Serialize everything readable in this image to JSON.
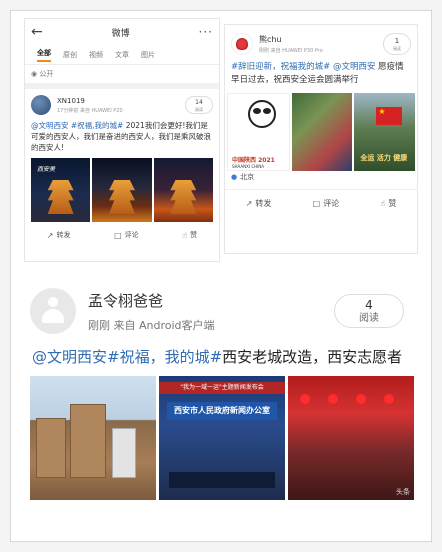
{
  "panel1": {
    "back_icon": "back-arrow-icon",
    "title": "微博",
    "more": "···",
    "tabs": [
      "全部",
      "原创",
      "视频",
      "文章",
      "图片"
    ],
    "public_label": "公开",
    "user": {
      "name": "XN1019",
      "meta": "17分钟前 来自 HUAWEI P20"
    },
    "read_count": "14",
    "read_label": "阅读",
    "text_prefix": "@文明西安 #祝福,我的城#",
    "text_body": " 2021我们会更好!我们是可爱的西安人，我们是奋进的西安人，我们是乘风破浪的西安人!",
    "photo_caption": "西安美",
    "actions": {
      "forward": "转发",
      "comment": "评论",
      "like": "赞"
    }
  },
  "panel2": {
    "user": {
      "name": "熊chu",
      "meta": "刚刚 来自 HUAWEI P30 Pro"
    },
    "read_count": "1",
    "read_label": "阅读",
    "text_prefix": "#辞旧迎新，祝福我的城# @文明西安",
    "text_body": " 愿疫情早日过去，祝西安全运会圆满举行",
    "photo1_title": "中国陕西 2021",
    "photo1_sub": "SHAANXI CHINA",
    "photo3_text": "全运 活力 健康",
    "location": "北京",
    "actions": {
      "forward": "转发",
      "comment": "评论",
      "like": "赞"
    }
  },
  "panel3": {
    "user": {
      "name": "孟令栩爸爸",
      "meta": "刚刚   来自 Android客户端"
    },
    "read_count": "4",
    "read_label": "阅读",
    "text_prefix": "@文明西安#祝福，我的城#",
    "text_body": "西安老城改造，西安志愿者",
    "photo2_banner_top": "\"我为一域一运\"主题新闻发布会",
    "photo2_banner": "西安市人民政府新闻办公室",
    "watermark": "头条"
  }
}
